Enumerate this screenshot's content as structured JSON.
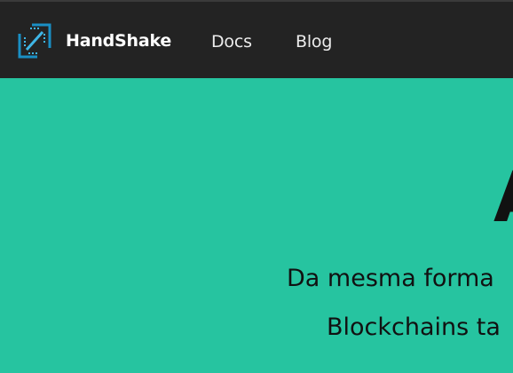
{
  "navbar": {
    "brand": "HandShake",
    "links": [
      "Docs",
      "Blog"
    ],
    "background": "#232323"
  },
  "hero": {
    "background": "#26c4a0",
    "title": "A",
    "line1": "Da mesma forma",
    "line2": "Blockchains ta"
  },
  "icons": {
    "logo": "handshake-logo-icon"
  }
}
